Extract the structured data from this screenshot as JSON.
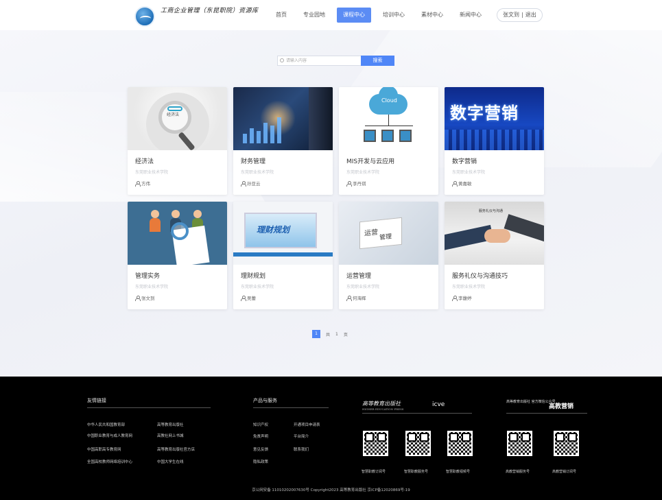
{
  "header": {
    "school_name": "工商企业管理（东昆职院）资源库",
    "nav": [
      "首页",
      "专业园地",
      "课程中心",
      "培训中心",
      "素材中心",
      "新闻中心"
    ],
    "active_nav": "课程中心",
    "user": {
      "name": "张文到",
      "separator": "|",
      "logout": "退出"
    }
  },
  "search": {
    "placeholder": "请输入内容",
    "button": "搜索"
  },
  "courses": [
    {
      "title": "经济法",
      "school": "东莞职业技术学院",
      "teacher": "方伟",
      "thumb_text": "经济法"
    },
    {
      "title": "财务管理",
      "school": "东莞职业技术学院",
      "teacher": "孙亚云"
    },
    {
      "title": "MIS开发与云应用",
      "school": "东莞职业技术学院",
      "teacher": "李丹琪",
      "thumb_text": "Cloud"
    },
    {
      "title": "数字营销",
      "school": "东莞职业技术学院",
      "teacher": "黄嘉敏",
      "thumb_text": "数字营销"
    },
    {
      "title": "管理实务",
      "school": "东莞职业技术学院",
      "teacher": "张文到"
    },
    {
      "title": "理财规划",
      "school": "东莞职业技术学院",
      "teacher": "吴蕾",
      "thumb_text": "理财规划"
    },
    {
      "title": "运营管理",
      "school": "东莞职业技术学院",
      "teacher": "何海辉",
      "thumb_text": "运营",
      "thumb_text2": "管理"
    },
    {
      "title": "服务礼仪与沟通技巧",
      "school": "东莞职业技术学院",
      "teacher": "李馥婷",
      "thumb_text": "服务礼仪与沟通"
    }
  ],
  "pagination": {
    "current": "1",
    "total_prefix": "共",
    "total": "1",
    "total_suffix": "页"
  },
  "footer": {
    "links_title": "友情链接",
    "links": [
      "中华人民共和国教育部",
      "高等教育出版社",
      "中国职业教育与成人教育网",
      "高教社网上书城",
      "中国高职高专教育网",
      "高等教育出版社官方店",
      "全国高校教师网络培训中心",
      "中国大学生在线"
    ],
    "services_title": "产品与服务",
    "services": [
      "知识产权",
      "开通项目申请表",
      "免责声明",
      "平台简介",
      "意见反馈",
      "联系我们",
      "隐私政策"
    ],
    "brand_hep": "高等教育出版社",
    "brand_hep_en": "HIGHER EDUCATION PRESS",
    "brand_icve": "icve",
    "brand_wechat": "高等教育出版社 官方微信公众号",
    "brand_promo": "高教营销",
    "qr_labels": [
      "智慧职教订阅号",
      "智慧职教服务号",
      "智慧职教视频号",
      "高教营销服务号",
      "高教营销订阅号"
    ],
    "copyright": "京公网安备 11010202007630号    Copyright2023 高等教育出版社    京ICP备12020869号-19"
  }
}
